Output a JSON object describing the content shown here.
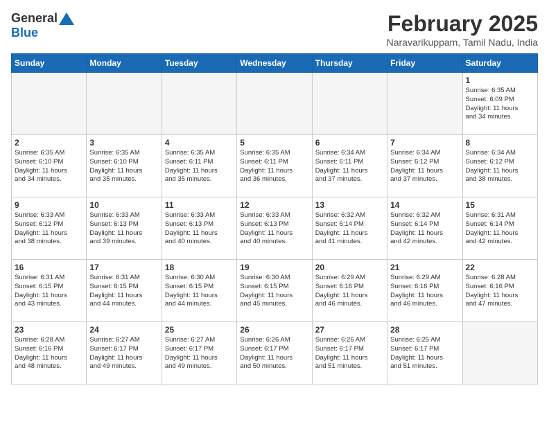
{
  "header": {
    "logo_general": "General",
    "logo_blue": "Blue",
    "month_title": "February 2025",
    "location": "Naravarikuppam, Tamil Nadu, India"
  },
  "calendar": {
    "days_of_week": [
      "Sunday",
      "Monday",
      "Tuesday",
      "Wednesday",
      "Thursday",
      "Friday",
      "Saturday"
    ],
    "weeks": [
      [
        {
          "day": "",
          "info": ""
        },
        {
          "day": "",
          "info": ""
        },
        {
          "day": "",
          "info": ""
        },
        {
          "day": "",
          "info": ""
        },
        {
          "day": "",
          "info": ""
        },
        {
          "day": "",
          "info": ""
        },
        {
          "day": "1",
          "info": "Sunrise: 6:35 AM\nSunset: 6:09 PM\nDaylight: 11 hours\nand 34 minutes."
        }
      ],
      [
        {
          "day": "2",
          "info": "Sunrise: 6:35 AM\nSunset: 6:10 PM\nDaylight: 11 hours\nand 34 minutes."
        },
        {
          "day": "3",
          "info": "Sunrise: 6:35 AM\nSunset: 6:10 PM\nDaylight: 11 hours\nand 35 minutes."
        },
        {
          "day": "4",
          "info": "Sunrise: 6:35 AM\nSunset: 6:11 PM\nDaylight: 11 hours\nand 35 minutes."
        },
        {
          "day": "5",
          "info": "Sunrise: 6:35 AM\nSunset: 6:11 PM\nDaylight: 11 hours\nand 36 minutes."
        },
        {
          "day": "6",
          "info": "Sunrise: 6:34 AM\nSunset: 6:11 PM\nDaylight: 11 hours\nand 37 minutes."
        },
        {
          "day": "7",
          "info": "Sunrise: 6:34 AM\nSunset: 6:12 PM\nDaylight: 11 hours\nand 37 minutes."
        },
        {
          "day": "8",
          "info": "Sunrise: 6:34 AM\nSunset: 6:12 PM\nDaylight: 11 hours\nand 38 minutes."
        }
      ],
      [
        {
          "day": "9",
          "info": "Sunrise: 6:33 AM\nSunset: 6:12 PM\nDaylight: 11 hours\nand 38 minutes."
        },
        {
          "day": "10",
          "info": "Sunrise: 6:33 AM\nSunset: 6:13 PM\nDaylight: 11 hours\nand 39 minutes."
        },
        {
          "day": "11",
          "info": "Sunrise: 6:33 AM\nSunset: 6:13 PM\nDaylight: 11 hours\nand 40 minutes."
        },
        {
          "day": "12",
          "info": "Sunrise: 6:33 AM\nSunset: 6:13 PM\nDaylight: 11 hours\nand 40 minutes."
        },
        {
          "day": "13",
          "info": "Sunrise: 6:32 AM\nSunset: 6:14 PM\nDaylight: 11 hours\nand 41 minutes."
        },
        {
          "day": "14",
          "info": "Sunrise: 6:32 AM\nSunset: 6:14 PM\nDaylight: 11 hours\nand 42 minutes."
        },
        {
          "day": "15",
          "info": "Sunrise: 6:31 AM\nSunset: 6:14 PM\nDaylight: 11 hours\nand 42 minutes."
        }
      ],
      [
        {
          "day": "16",
          "info": "Sunrise: 6:31 AM\nSunset: 6:15 PM\nDaylight: 11 hours\nand 43 minutes."
        },
        {
          "day": "17",
          "info": "Sunrise: 6:31 AM\nSunset: 6:15 PM\nDaylight: 11 hours\nand 44 minutes."
        },
        {
          "day": "18",
          "info": "Sunrise: 6:30 AM\nSunset: 6:15 PM\nDaylight: 11 hours\nand 44 minutes."
        },
        {
          "day": "19",
          "info": "Sunrise: 6:30 AM\nSunset: 6:15 PM\nDaylight: 11 hours\nand 45 minutes."
        },
        {
          "day": "20",
          "info": "Sunrise: 6:29 AM\nSunset: 6:16 PM\nDaylight: 11 hours\nand 46 minutes."
        },
        {
          "day": "21",
          "info": "Sunrise: 6:29 AM\nSunset: 6:16 PM\nDaylight: 11 hours\nand 46 minutes."
        },
        {
          "day": "22",
          "info": "Sunrise: 6:28 AM\nSunset: 6:16 PM\nDaylight: 11 hours\nand 47 minutes."
        }
      ],
      [
        {
          "day": "23",
          "info": "Sunrise: 6:28 AM\nSunset: 6:16 PM\nDaylight: 11 hours\nand 48 minutes."
        },
        {
          "day": "24",
          "info": "Sunrise: 6:27 AM\nSunset: 6:17 PM\nDaylight: 11 hours\nand 49 minutes."
        },
        {
          "day": "25",
          "info": "Sunrise: 6:27 AM\nSunset: 6:17 PM\nDaylight: 11 hours\nand 49 minutes."
        },
        {
          "day": "26",
          "info": "Sunrise: 6:26 AM\nSunset: 6:17 PM\nDaylight: 11 hours\nand 50 minutes."
        },
        {
          "day": "27",
          "info": "Sunrise: 6:26 AM\nSunset: 6:17 PM\nDaylight: 11 hours\nand 51 minutes."
        },
        {
          "day": "28",
          "info": "Sunrise: 6:25 AM\nSunset: 6:17 PM\nDaylight: 11 hours\nand 51 minutes."
        },
        {
          "day": "",
          "info": ""
        }
      ]
    ]
  }
}
